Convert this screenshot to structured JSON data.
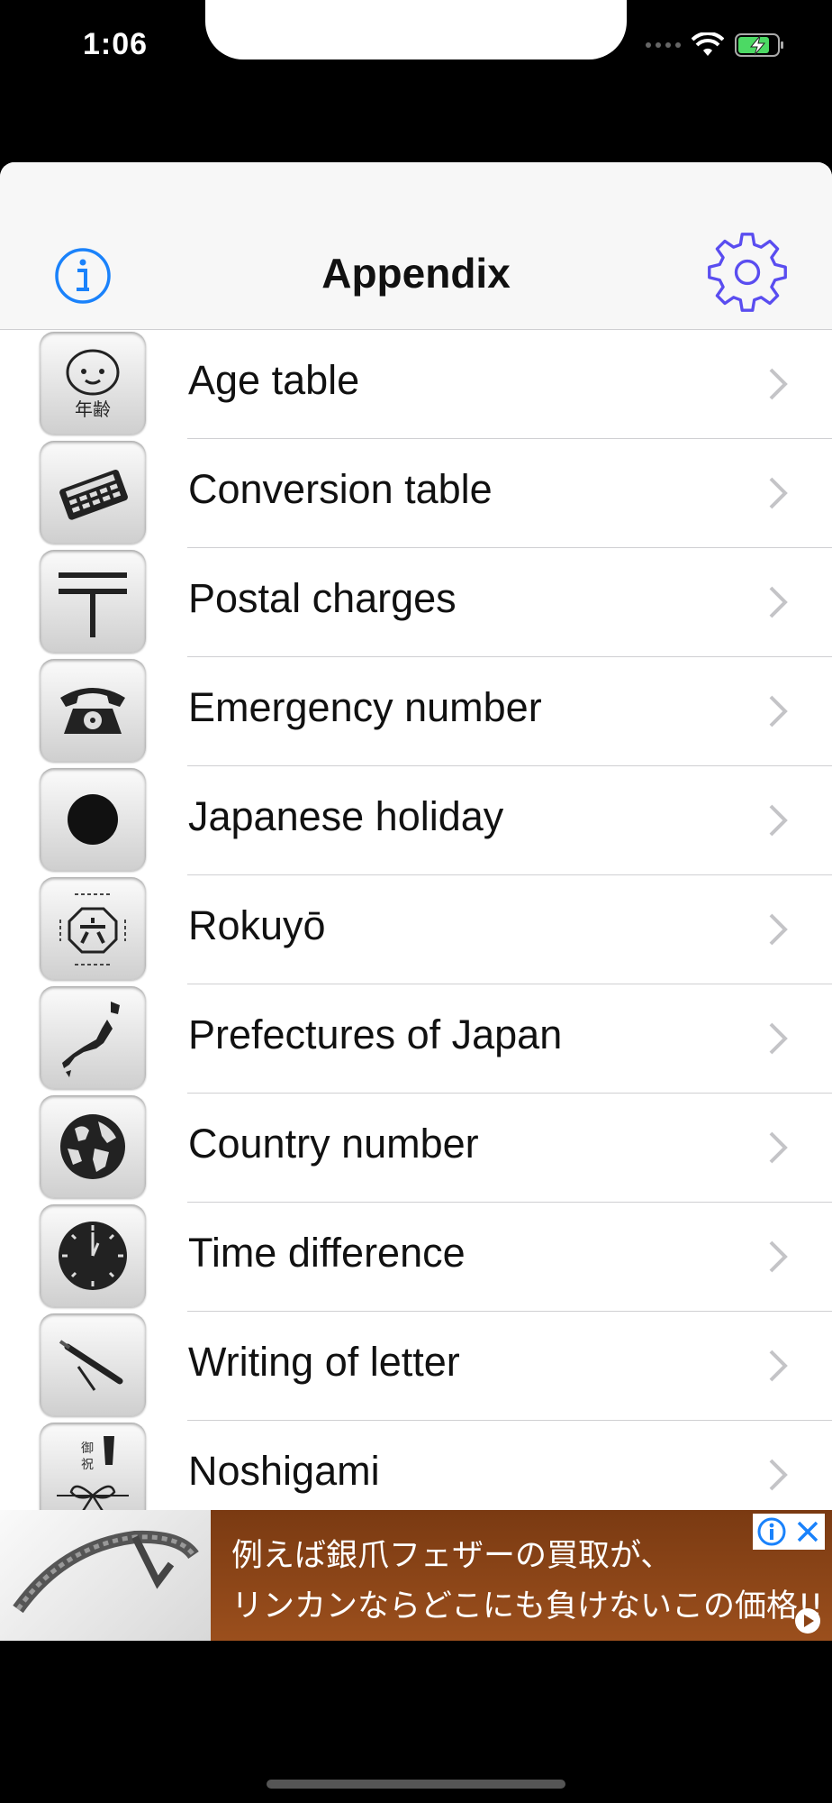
{
  "status_bar": {
    "time": "1:06"
  },
  "nav_bar": {
    "title": "Appendix",
    "left_icon": "info-icon",
    "right_icon": "gear-icon"
  },
  "list": {
    "items": [
      {
        "label": "Age table",
        "icon": "baby-face-icon"
      },
      {
        "label": "Conversion table",
        "icon": "calculator-icon"
      },
      {
        "label": "Postal charges",
        "icon": "postal-mark-icon"
      },
      {
        "label": "Emergency number",
        "icon": "telephone-icon"
      },
      {
        "label": "Japanese holiday",
        "icon": "hinomaru-icon"
      },
      {
        "label": "Rokuyō",
        "icon": "rokuyo-seal-icon"
      },
      {
        "label": "Prefectures of Japan",
        "icon": "japan-map-icon"
      },
      {
        "label": "Country number",
        "icon": "globe-icon"
      },
      {
        "label": "Time difference",
        "icon": "clock-icon"
      },
      {
        "label": "Writing of letter",
        "icon": "pen-icon"
      },
      {
        "label": "Noshigami",
        "icon": "noshi-ribbon-icon"
      }
    ]
  },
  "ad": {
    "line1": "例えば銀爪フェザーの買取が、",
    "line2": "リンカンならどこにも負けないこの価格!!",
    "colors": {
      "background": "#8b4416",
      "text": "#ffffff"
    }
  },
  "colors": {
    "accent": "#1a82fb",
    "gear": "#5a4df0",
    "separator": "#cfcfd2"
  }
}
